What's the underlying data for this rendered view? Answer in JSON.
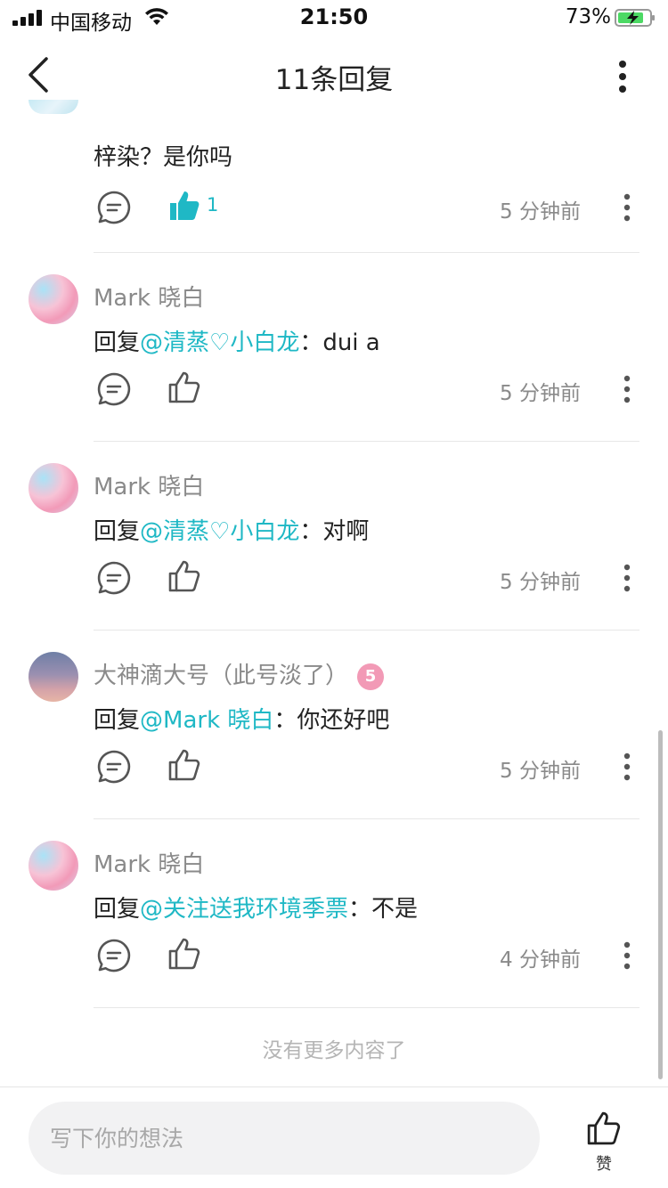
{
  "status_bar": {
    "carrier": "中国移动",
    "time": "21:50",
    "battery": "73%"
  },
  "nav": {
    "title": "11条回复"
  },
  "partial_comment": {
    "content": "梓染？是你吗",
    "like_count": "1",
    "timestamp": "5 分钟前",
    "liked": true
  },
  "comments": [
    {
      "username": "Mark 晓白",
      "reply_prefix": "回复",
      "mention": "@清蒸♡小白龙",
      "text": "：dui a",
      "timestamp": "5 分钟前",
      "avatar": "anime"
    },
    {
      "username": "Mark 晓白",
      "reply_prefix": "回复",
      "mention": "@清蒸♡小白龙",
      "text": "：对啊",
      "timestamp": "5 分钟前",
      "avatar": "anime"
    },
    {
      "username": "大神滴大号（此号淡了）",
      "badge": "5",
      "reply_prefix": "回复",
      "mention": "@Mark 晓白",
      "text": "：你还好吧",
      "timestamp": "5 分钟前",
      "avatar": "dusk"
    },
    {
      "username": "Mark 晓白",
      "reply_prefix": "回复",
      "mention": "@关注送我环境季票",
      "text": "：不是",
      "timestamp": "4 分钟前",
      "avatar": "anime"
    }
  ],
  "end_text": "没有更多内容了",
  "bottom_bar": {
    "placeholder": "写下你的想法",
    "like_label": "赞"
  },
  "colors": {
    "accent": "#1fb8c5",
    "muted_text": "#8a8a8a",
    "divider": "#e7e7e7"
  },
  "icons": {
    "back": "chevron-left-icon",
    "more": "more-vertical-icon",
    "reply": "comment-bubble-icon",
    "like": "thumbs-up-icon"
  }
}
